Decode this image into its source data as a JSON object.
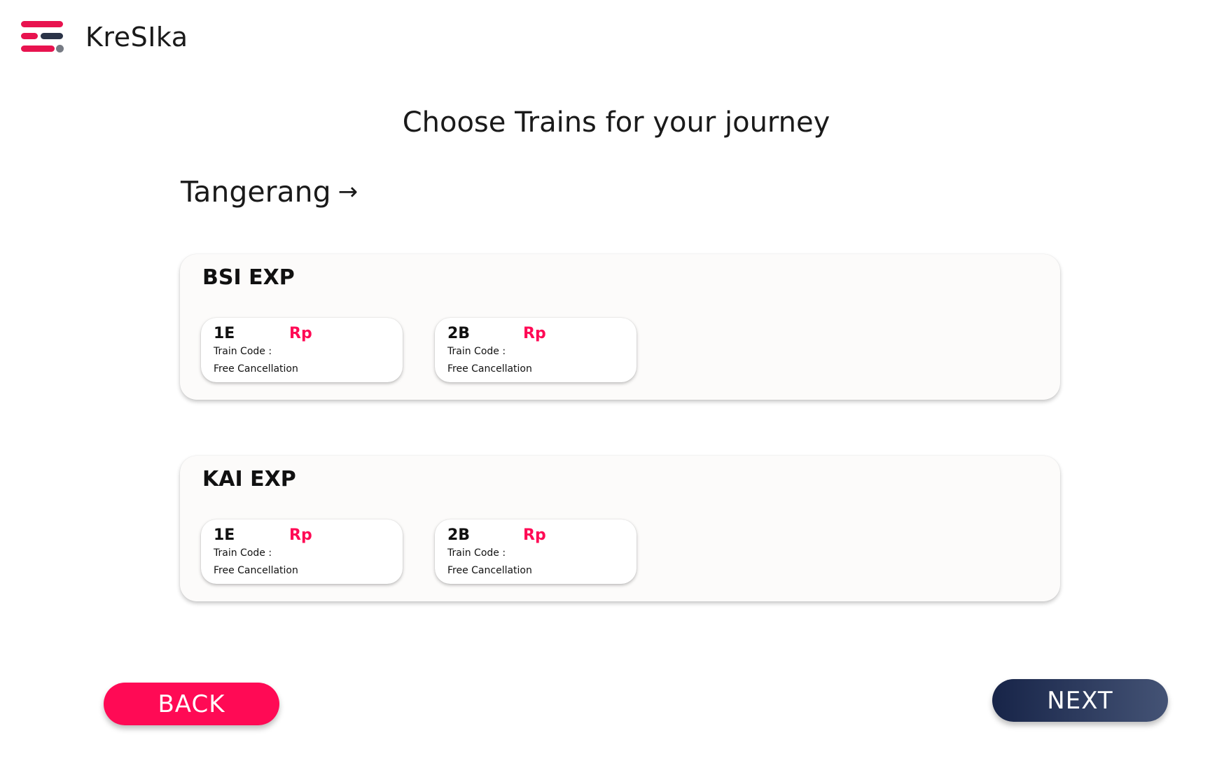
{
  "app": {
    "name": "KreSIka"
  },
  "colors": {
    "accent": "#ff0a55",
    "brand_dark": "#2a3347",
    "next_gradient_start": "#172448",
    "next_gradient_end": "#445375",
    "card_background": "#fcfbfa"
  },
  "header": {
    "logo_icon": "menu-lines-logo-icon",
    "title": "Choose Trains for your journey"
  },
  "route": {
    "origin": "Tangerang",
    "arrow": "→"
  },
  "trains": [
    {
      "name": "BSI EXP",
      "classes": [
        {
          "code": "1E",
          "price_label": "Rp",
          "train_code_label": "Train Code :",
          "cancellation": "Free Cancellation"
        },
        {
          "code": "2B",
          "price_label": "Rp",
          "train_code_label": "Train Code :",
          "cancellation": "Free Cancellation"
        }
      ]
    },
    {
      "name": "KAI EXP",
      "classes": [
        {
          "code": "1E",
          "price_label": "Rp",
          "train_code_label": "Train Code :",
          "cancellation": "Free Cancellation"
        },
        {
          "code": "2B",
          "price_label": "Rp",
          "train_code_label": "Train Code :",
          "cancellation": "Free Cancellation"
        }
      ]
    }
  ],
  "footer": {
    "back_label": "BACK",
    "next_label": "NEXT"
  }
}
